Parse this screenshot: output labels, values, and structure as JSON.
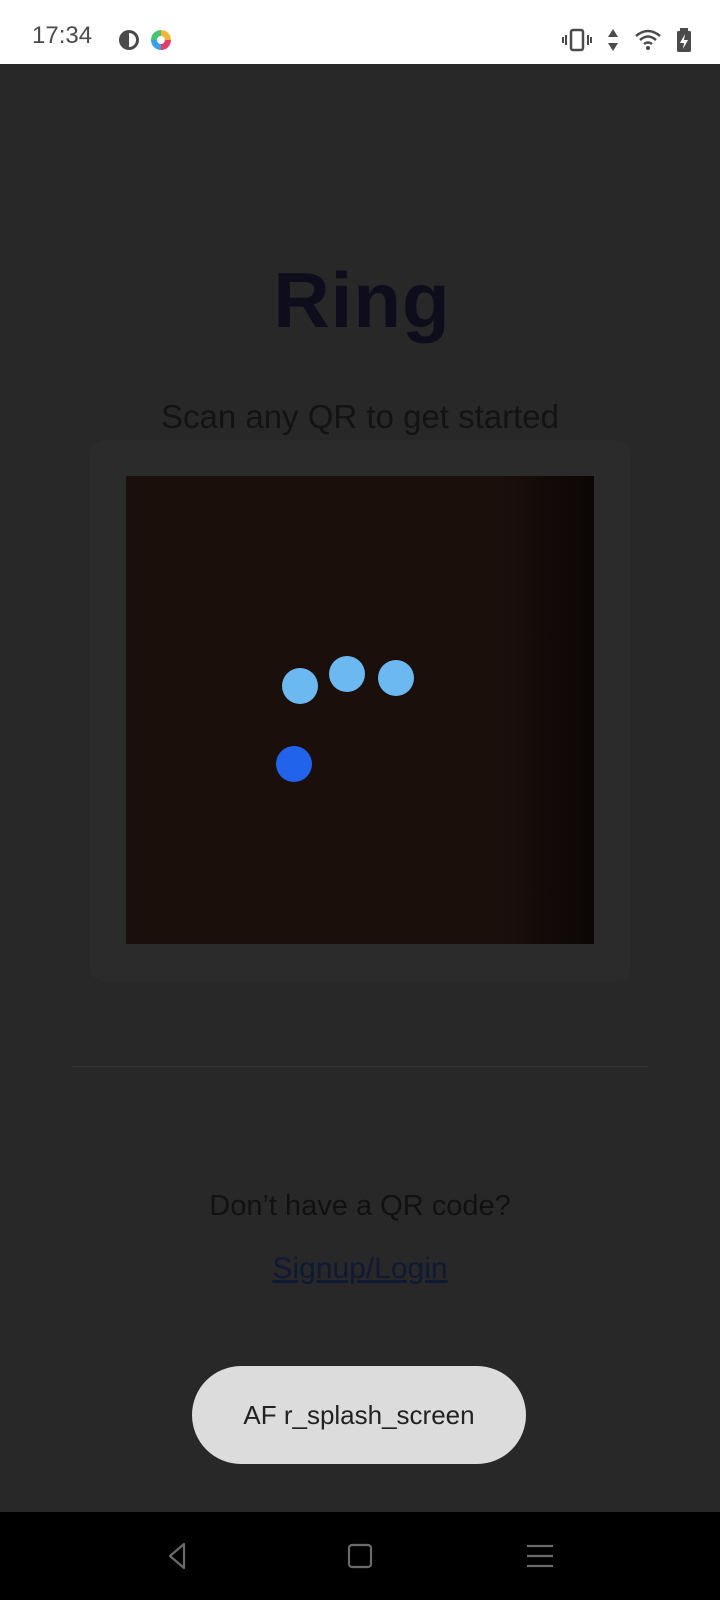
{
  "status_bar": {
    "time": "17:34",
    "icons": [
      "circle-app-icon",
      "colorful-app-icon",
      "vibrate-icon",
      "data-arrows-icon",
      "wifi-icon",
      "battery-charging-icon"
    ]
  },
  "logo": {
    "text": "Ring"
  },
  "scan": {
    "title": "Scan any QR to get started",
    "loading_dots": [
      "#6BB9F0",
      "#6BB9F0",
      "#6BB9F0",
      "#2163EB"
    ]
  },
  "bottom": {
    "prompt": "Don’t have a QR code?",
    "link_label": "Signup/Login"
  },
  "toast": {
    "text": "AF r_splash_screen"
  },
  "colors": {
    "background": "#282828",
    "camera_bg": "#1B0F0C",
    "toast_bg": "#DCDCDC",
    "logo_color": "#0D0D1C"
  },
  "nav_bar": {
    "buttons": [
      "back-icon",
      "home-icon",
      "recents-icon"
    ]
  }
}
